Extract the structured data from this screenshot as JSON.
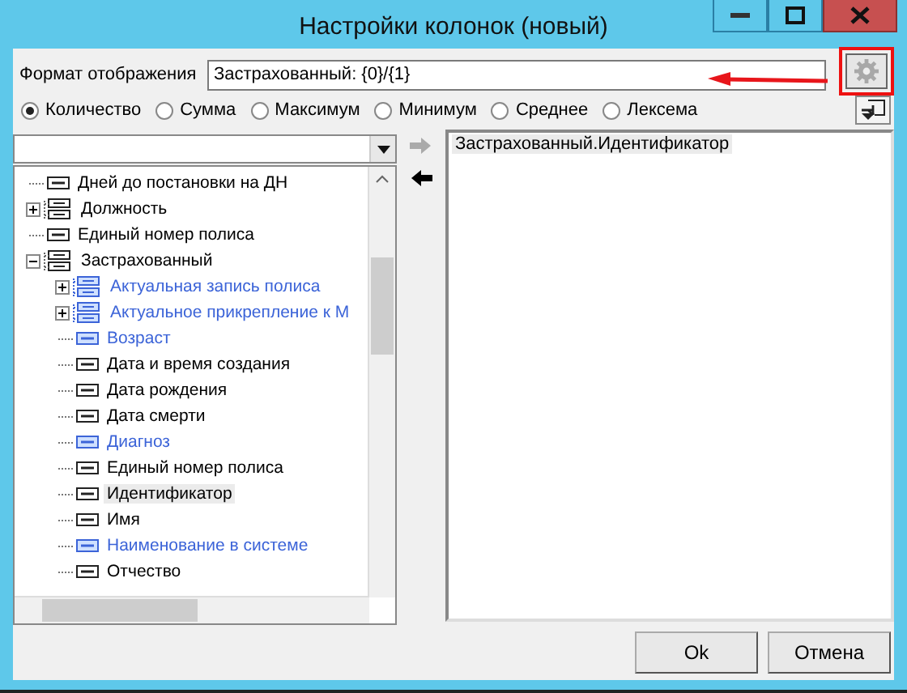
{
  "window": {
    "title": "Настройки колонок (новый)"
  },
  "format": {
    "label": "Формат отображения",
    "value": "Застрахованный: {0}/{1}"
  },
  "aggregates": [
    {
      "label": "Количество",
      "selected": true
    },
    {
      "label": "Сумма",
      "selected": false
    },
    {
      "label": "Максимум",
      "selected": false
    },
    {
      "label": "Минимум",
      "selected": false
    },
    {
      "label": "Среднее",
      "selected": false
    },
    {
      "label": "Лексема",
      "selected": false
    }
  ],
  "tree": [
    {
      "kind": "field",
      "label": "Дней до постановки на ДН",
      "selected": false
    },
    {
      "kind": "group",
      "label": "Должность",
      "expanded": false,
      "selected": false
    },
    {
      "kind": "field",
      "label": "Единый номер полиса",
      "selected": false
    },
    {
      "kind": "group",
      "label": "Застрахованный",
      "expanded": true,
      "selected": false,
      "children": [
        {
          "kind": "group",
          "label": "Актуальная запись полиса",
          "expanded": false,
          "selected": false,
          "color": "#3c64d8"
        },
        {
          "kind": "group",
          "label": "Актуальное прикрепление к М",
          "expanded": false,
          "selected": false,
          "color": "#3c64d8"
        },
        {
          "kind": "field",
          "label": "Возраст",
          "selected": false,
          "color": "#3c64d8"
        },
        {
          "kind": "field",
          "label": "Дата и время создания",
          "selected": false
        },
        {
          "kind": "field",
          "label": "Дата рождения",
          "selected": false
        },
        {
          "kind": "field",
          "label": "Дата смерти",
          "selected": false
        },
        {
          "kind": "field",
          "label": "Диагноз",
          "selected": false,
          "color": "#3c64d8"
        },
        {
          "kind": "field",
          "label": "Единый номер полиса",
          "selected": false
        },
        {
          "kind": "field",
          "label": "Идентификатор",
          "selected": true
        },
        {
          "kind": "field",
          "label": "Имя",
          "selected": false
        },
        {
          "kind": "field",
          "label": "Наименование в системе",
          "selected": false,
          "color": "#3c64d8"
        },
        {
          "kind": "field",
          "label": "Отчество",
          "selected": false
        }
      ]
    }
  ],
  "columns": [
    {
      "label": "Застрахованный.Идентификатор",
      "selected": true
    }
  ],
  "buttons": [
    {
      "label": "Ok"
    },
    {
      "label": "Отмена"
    }
  ]
}
